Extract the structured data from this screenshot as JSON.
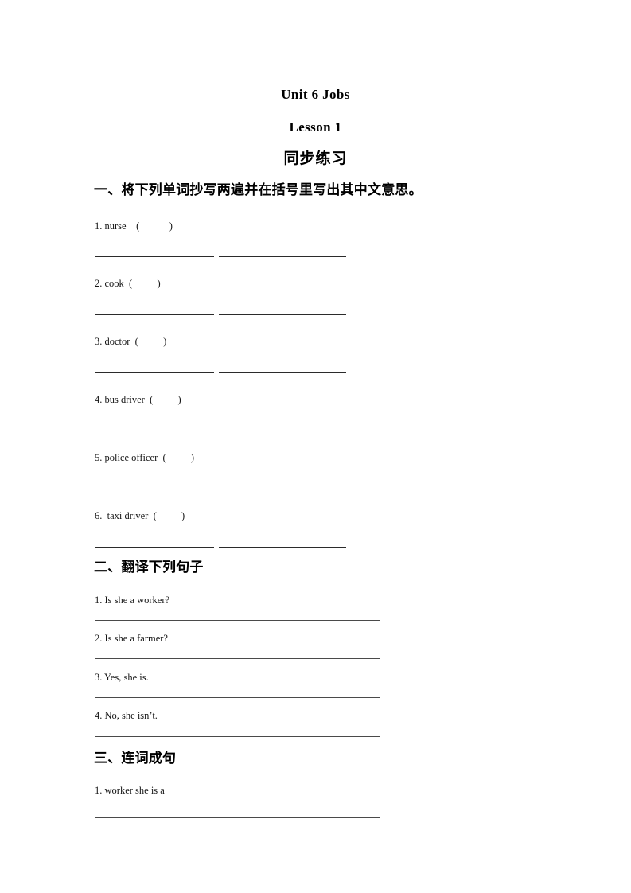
{
  "document": {
    "title_unit": "Unit 6 Jobs",
    "title_lesson": "Lesson  1",
    "title_cn": "同步练习"
  },
  "sections": [
    {
      "heading": "一、将下列单词抄写两遍并在括号里写出其中文意思。",
      "type": "copy-words",
      "items": [
        {
          "number": "1.",
          "text": "1. nurse    (            )"
        },
        {
          "number": "2.",
          "text": "2. cook  (          )"
        },
        {
          "number": "3.",
          "text": "3. doctor  (          )"
        },
        {
          "number": "4.",
          "text": "4. bus driver  (          )"
        },
        {
          "number": "5.",
          "text": "5. police officer  (          )"
        },
        {
          "number": "6.",
          "text": "6.  taxi driver  (          )"
        }
      ]
    },
    {
      "heading": "二、翻译下列句子",
      "type": "translate",
      "items": [
        {
          "number": "1.",
          "text": "1. Is she a worker?"
        },
        {
          "number": "2.",
          "text": "2. Is she a farmer?"
        },
        {
          "number": "3.",
          "text": "3. Yes, she is."
        },
        {
          "number": "4.",
          "text": "4. No, she isn’t."
        }
      ]
    },
    {
      "heading": "三、连词成句",
      "type": "word-order",
      "items": [
        {
          "number": "1.",
          "text": "1. worker she is a"
        }
      ]
    }
  ]
}
